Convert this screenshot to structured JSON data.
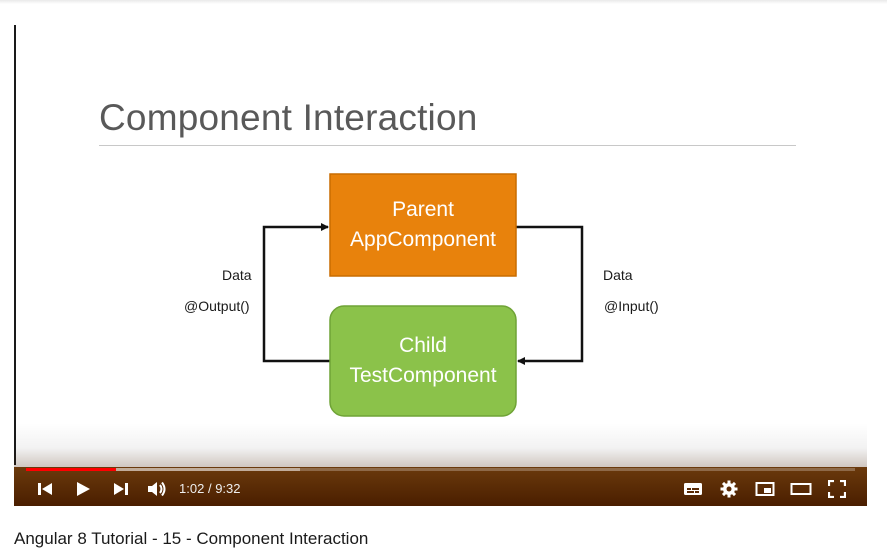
{
  "slide": {
    "title": "Component Interaction",
    "parent_box": {
      "line1": "Parent",
      "line2": "AppComponent",
      "color": "#e8820c"
    },
    "child_box": {
      "line1": "Child",
      "line2": "TestComponent",
      "color": "#8bc24a"
    },
    "left_label": {
      "line1": "Data",
      "line2": "@Output()"
    },
    "right_label": {
      "line1": "Data",
      "line2": "@Input()"
    }
  },
  "player": {
    "current_time": "1:02",
    "separator": "/",
    "duration": "9:32",
    "progress_fraction": 0.108,
    "buffered_fraction": 0.33,
    "progress_color": "#ff0000",
    "icons": {
      "prev": "skip-previous-icon",
      "play": "play-icon",
      "next": "skip-next-icon",
      "volume": "volume-icon",
      "subtitles": "subtitles-icon",
      "settings": "gear-icon",
      "miniplayer": "miniplayer-icon",
      "theater": "theater-mode-icon",
      "fullscreen": "fullscreen-icon"
    }
  },
  "video_title": "Angular 8 Tutorial - 15 - Component Interaction"
}
